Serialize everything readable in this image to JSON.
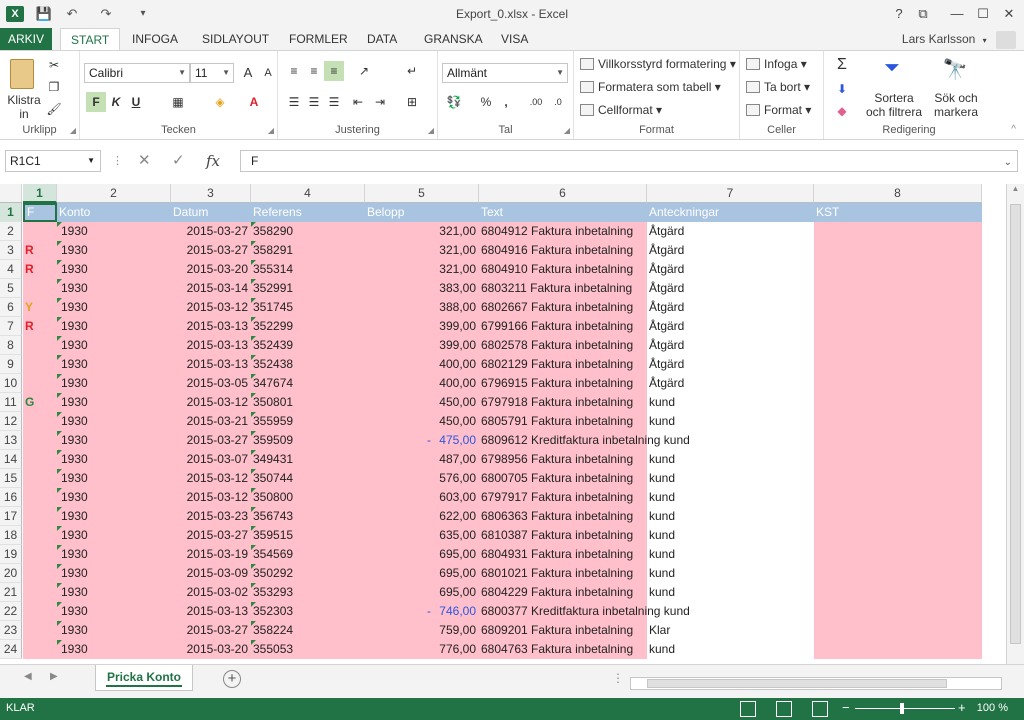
{
  "window": {
    "title": "Export_0.xlsx - Excel",
    "app_icon": "X",
    "controls": [
      "?",
      "⧉",
      "—",
      "☐",
      "✕"
    ]
  },
  "ribbon_tabs": [
    {
      "label": "ARKIV"
    },
    {
      "label": "START"
    },
    {
      "label": "INFOGA"
    },
    {
      "label": "SIDLAYOUT"
    },
    {
      "label": "FORMLER"
    },
    {
      "label": "DATA"
    },
    {
      "label": "GRANSKA"
    },
    {
      "label": "VISA"
    }
  ],
  "user": {
    "name": "Lars Karlsson"
  },
  "ribbon": {
    "clipboard": {
      "paste_label": "Klistra in",
      "group_label": "Urklipp"
    },
    "font": {
      "font_name": "Calibri",
      "font_size": "11",
      "bold": "F",
      "italic": "K",
      "underline": "U",
      "group_label": "Tecken"
    },
    "alignment": {
      "group_label": "Justering"
    },
    "number": {
      "format": "Allmänt",
      "percent": "%",
      "comma": ",",
      "group_label": "Tal"
    },
    "styles": {
      "cond_format": "Villkorsstyrd formatering",
      "format_table": "Formatera som tabell",
      "cell_styles": "Cellformat",
      "group_label": "Format"
    },
    "cells": {
      "insert": "Infoga",
      "delete": "Ta bort",
      "format": "Format",
      "group_label": "Celler"
    },
    "editing": {
      "sort_filter": "Sortera och filtrera",
      "find_select": "Sök och markera",
      "group_label": "Redigering"
    }
  },
  "formula_bar": {
    "name_box": "R1C1",
    "content": "F",
    "fx": "fx"
  },
  "columns": [
    "1",
    "2",
    "3",
    "4",
    "5",
    "6",
    "7",
    "8"
  ],
  "header_row": [
    "F",
    "Konto",
    "Datum",
    "Referens",
    "Belopp",
    "Text",
    "Anteckningar",
    "KST"
  ],
  "rows": [
    {
      "n": "2",
      "f": "",
      "konto": "1930",
      "datum": "2015-03-27",
      "ref": "358290",
      "neg": "",
      "belopp": "321,00",
      "text": "6804912 Faktura inbetalning",
      "note": "Åtgärd"
    },
    {
      "n": "3",
      "f": "R",
      "konto": "1930",
      "datum": "2015-03-27",
      "ref": "358291",
      "neg": "",
      "belopp": "321,00",
      "text": "6804916 Faktura inbetalning",
      "note": "Åtgärd"
    },
    {
      "n": "4",
      "f": "R",
      "konto": "1930",
      "datum": "2015-03-20",
      "ref": "355314",
      "neg": "",
      "belopp": "321,00",
      "text": "6804910 Faktura inbetalning",
      "note": "Åtgärd"
    },
    {
      "n": "5",
      "f": "",
      "konto": "1930",
      "datum": "2015-03-14",
      "ref": "352991",
      "neg": "",
      "belopp": "383,00",
      "text": "6803211 Faktura inbetalning",
      "note": "Åtgärd"
    },
    {
      "n": "6",
      "f": "Y",
      "konto": "1930",
      "datum": "2015-03-12",
      "ref": "351745",
      "neg": "",
      "belopp": "388,00",
      "text": "6802667 Faktura inbetalning",
      "note": "Åtgärd"
    },
    {
      "n": "7",
      "f": "R",
      "konto": "1930",
      "datum": "2015-03-13",
      "ref": "352299",
      "neg": "",
      "belopp": "399,00",
      "text": "6799166 Faktura inbetalning",
      "note": "Åtgärd"
    },
    {
      "n": "8",
      "f": "",
      "konto": "1930",
      "datum": "2015-03-13",
      "ref": "352439",
      "neg": "",
      "belopp": "399,00",
      "text": "6802578 Faktura inbetalning",
      "note": "Åtgärd"
    },
    {
      "n": "9",
      "f": "",
      "konto": "1930",
      "datum": "2015-03-13",
      "ref": "352438",
      "neg": "",
      "belopp": "400,00",
      "text": "6802129 Faktura inbetalning",
      "note": "Åtgärd"
    },
    {
      "n": "10",
      "f": "",
      "konto": "1930",
      "datum": "2015-03-05",
      "ref": "347674",
      "neg": "",
      "belopp": "400,00",
      "text": "6796915 Faktura inbetalning",
      "note": "Åtgärd"
    },
    {
      "n": "11",
      "f": "G",
      "konto": "1930",
      "datum": "2015-03-12",
      "ref": "350801",
      "neg": "",
      "belopp": "450,00",
      "text": "6797918 Faktura inbetalning",
      "note": "kund"
    },
    {
      "n": "12",
      "f": "",
      "konto": "1930",
      "datum": "2015-03-21",
      "ref": "355959",
      "neg": "",
      "belopp": "450,00",
      "text": "6805791 Faktura inbetalning",
      "note": "kund"
    },
    {
      "n": "13",
      "f": "",
      "konto": "1930",
      "datum": "2015-03-27",
      "ref": "359509",
      "neg": "-",
      "belopp": "475,00",
      "text": "6809612 Kreditfaktura inbetalning kund",
      "note": ""
    },
    {
      "n": "14",
      "f": "",
      "konto": "1930",
      "datum": "2015-03-07",
      "ref": "349431",
      "neg": "",
      "belopp": "487,00",
      "text": "6798956 Faktura inbetalning",
      "note": "kund"
    },
    {
      "n": "15",
      "f": "",
      "konto": "1930",
      "datum": "2015-03-12",
      "ref": "350744",
      "neg": "",
      "belopp": "576,00",
      "text": "6800705 Faktura inbetalning",
      "note": "kund"
    },
    {
      "n": "16",
      "f": "",
      "konto": "1930",
      "datum": "2015-03-12",
      "ref": "350800",
      "neg": "",
      "belopp": "603,00",
      "text": "6797917 Faktura inbetalning",
      "note": "kund"
    },
    {
      "n": "17",
      "f": "",
      "konto": "1930",
      "datum": "2015-03-23",
      "ref": "356743",
      "neg": "",
      "belopp": "622,00",
      "text": "6806363 Faktura inbetalning",
      "note": "kund"
    },
    {
      "n": "18",
      "f": "",
      "konto": "1930",
      "datum": "2015-03-27",
      "ref": "359515",
      "neg": "",
      "belopp": "635,00",
      "text": "6810387 Faktura inbetalning",
      "note": "kund"
    },
    {
      "n": "19",
      "f": "",
      "konto": "1930",
      "datum": "2015-03-19",
      "ref": "354569",
      "neg": "",
      "belopp": "695,00",
      "text": "6804931 Faktura inbetalning",
      "note": "kund"
    },
    {
      "n": "20",
      "f": "",
      "konto": "1930",
      "datum": "2015-03-09",
      "ref": "350292",
      "neg": "",
      "belopp": "695,00",
      "text": "6801021 Faktura inbetalning",
      "note": "kund"
    },
    {
      "n": "21",
      "f": "",
      "konto": "1930",
      "datum": "2015-03-02",
      "ref": "353293",
      "neg": "",
      "belopp": "695,00",
      "text": "6804229 Faktura inbetalning",
      "note": "kund"
    },
    {
      "n": "22",
      "f": "",
      "konto": "1930",
      "datum": "2015-03-13",
      "ref": "352303",
      "neg": "-",
      "belopp": "746,00",
      "text": "6800377 Kreditfaktura inbetalning kund",
      "note": ""
    },
    {
      "n": "23",
      "f": "",
      "konto": "1930",
      "datum": "2015-03-27",
      "ref": "358224",
      "neg": "",
      "belopp": "759,00",
      "text": "6809201 Faktura inbetalning",
      "note": "Klar"
    },
    {
      "n": "24",
      "f": "",
      "konto": "1930",
      "datum": "2015-03-20",
      "ref": "355053",
      "neg": "",
      "belopp": "776,00",
      "text": "6804763 Faktura inbetalning",
      "note": "kund"
    }
  ],
  "sheet_tab": "Pricka Konto",
  "status": {
    "ready": "KLAR",
    "zoom": "100 %"
  },
  "colors": {
    "brand": "#217346",
    "row_fill": "#ffc0cb",
    "header_fill": "#a9c4e0",
    "flag_R": "#e0202a",
    "flag_Y": "#e3a21a",
    "flag_G": "#2a8a3f",
    "negative": "#2a56e0"
  }
}
